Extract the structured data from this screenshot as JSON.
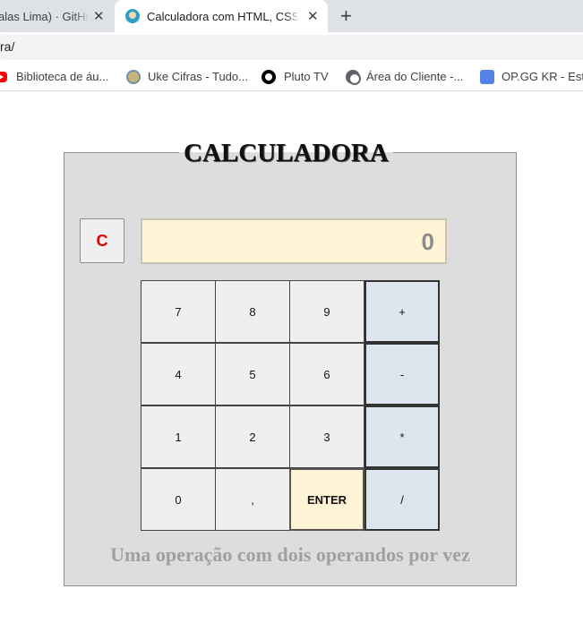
{
  "browser": {
    "tabs": [
      {
        "title": "alas Lima) · GitHub",
        "close": "✕"
      },
      {
        "title": "Calculadora com HTML, CSS e JS",
        "close": "✕"
      }
    ],
    "new_tab": "+",
    "url": "ra/",
    "bookmarks": [
      {
        "label": "Biblioteca de áu...",
        "icon": "youtube-icon"
      },
      {
        "label": "Uke Cifras - Tudo...",
        "icon": "uke-cifras-icon"
      },
      {
        "label": "Pluto TV",
        "icon": "pluto-tv-icon"
      },
      {
        "label": "Área do Cliente -...",
        "icon": "globe-icon"
      },
      {
        "label": "OP.GG KR - Esta",
        "icon": "opgg-icon"
      }
    ]
  },
  "calculator": {
    "title": "CALCULADORA",
    "clear_label": "C",
    "display_value": "0",
    "keys": [
      {
        "label": "7"
      },
      {
        "label": "8"
      },
      {
        "label": "9"
      },
      {
        "label": "+"
      },
      {
        "label": "4"
      },
      {
        "label": "5"
      },
      {
        "label": "6"
      },
      {
        "label": "-"
      },
      {
        "label": "1"
      },
      {
        "label": "2"
      },
      {
        "label": "3"
      },
      {
        "label": "*"
      },
      {
        "label": "0"
      },
      {
        "label": ","
      },
      {
        "label": "ENTER"
      },
      {
        "label": "/"
      }
    ],
    "caption": "Uma operação com dois operandos por vez"
  },
  "colors": {
    "display_bg": "#fff5d6",
    "operator_bg": "#dde6ee",
    "clear_text": "#e00000",
    "panel_bg": "#dddddd"
  }
}
